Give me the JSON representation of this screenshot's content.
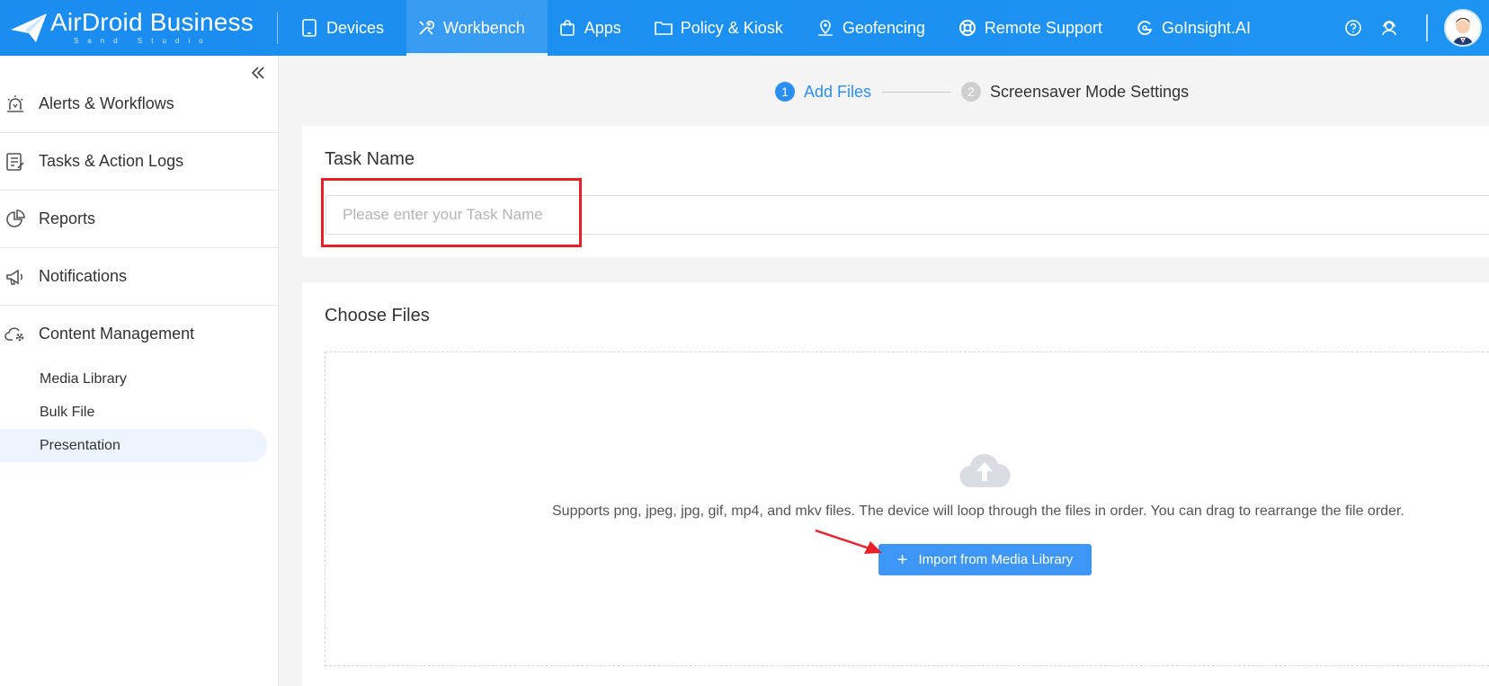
{
  "header": {
    "brand": "AirDroid Business",
    "brand_sub": "Sand Studio",
    "nav": [
      {
        "label": "Devices",
        "icon": "tablet-icon"
      },
      {
        "label": "Workbench",
        "icon": "tools-icon",
        "active": true
      },
      {
        "label": "Apps",
        "icon": "shopping-bag-icon"
      },
      {
        "label": "Policy & Kiosk",
        "icon": "folder-icon"
      },
      {
        "label": "Geofencing",
        "icon": "map-pin-icon"
      },
      {
        "label": "Remote Support",
        "icon": "lifebuoy-icon"
      },
      {
        "label": "GoInsight.AI",
        "icon": "goinsight-icon"
      }
    ],
    "right_icons": [
      "help-icon",
      "support-agent-icon"
    ],
    "accent": "#1e90f0"
  },
  "sidebar": {
    "items": [
      {
        "label": "Alerts & Workflows",
        "icon": "alarm-icon"
      },
      {
        "label": "Tasks & Action Logs",
        "icon": "task-log-icon"
      },
      {
        "label": "Reports",
        "icon": "pie-chart-icon"
      },
      {
        "label": "Notifications",
        "icon": "megaphone-icon"
      },
      {
        "label": "Content Management",
        "icon": "cloud-gear-icon"
      }
    ],
    "sub_items": [
      {
        "label": "Media Library"
      },
      {
        "label": "Bulk File"
      },
      {
        "label": "Presentation",
        "active": true
      }
    ]
  },
  "steps": [
    {
      "num": "1",
      "label": "Add Files",
      "active": true
    },
    {
      "num": "2",
      "label": "Screensaver Mode Settings",
      "active": false
    }
  ],
  "task": {
    "title": "Task Name",
    "placeholder": "Please enter your Task Name",
    "value": ""
  },
  "files": {
    "title": "Choose Files",
    "support_text": "Supports png, jpeg, jpg, gif, mp4, and mkv files. The device will loop through the files in order. You can drag to rearrange the file order.",
    "import_label": "Import from Media Library"
  },
  "annotation_colors": {
    "highlight": "#e8202a"
  }
}
